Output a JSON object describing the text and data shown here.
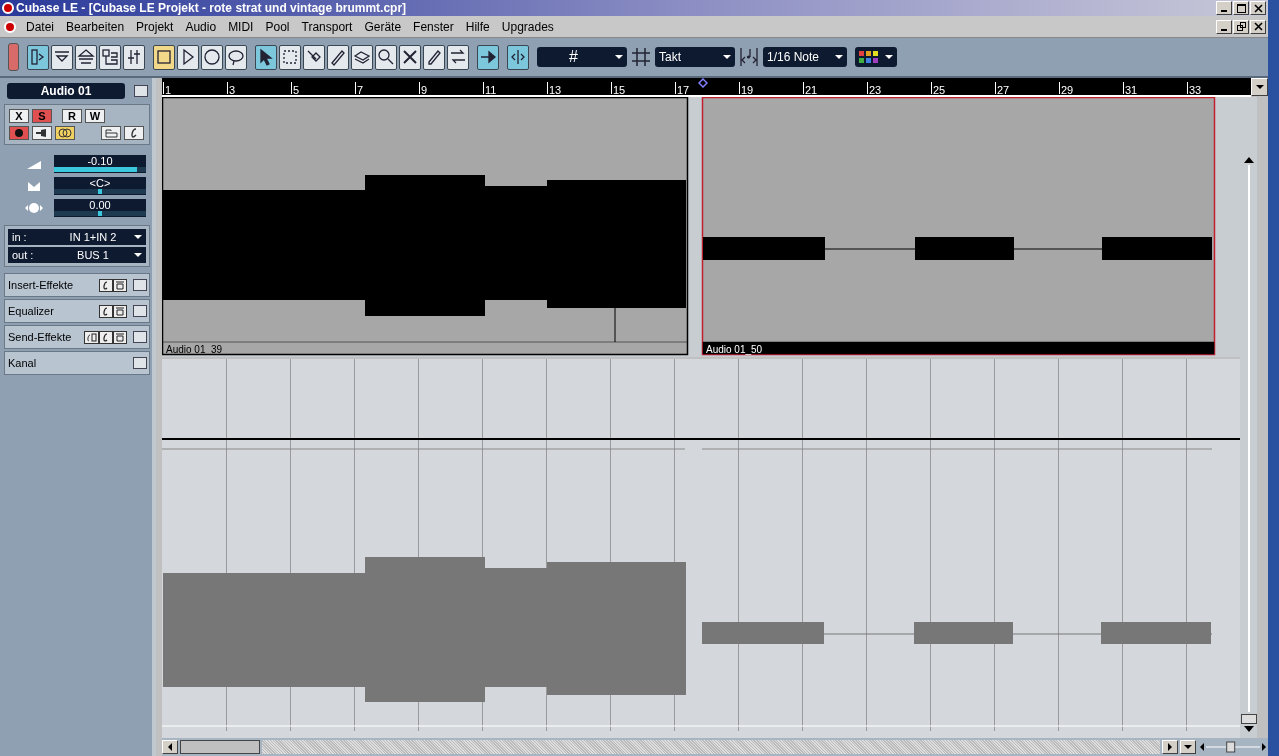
{
  "window": {
    "title": "Cubase LE - [Cubase LE Projekt - rote strat und vintage brummt.cpr]"
  },
  "menu": [
    "Datei",
    "Bearbeiten",
    "Projekt",
    "Audio",
    "MIDI",
    "Pool",
    "Transport",
    "Geräte",
    "Fenster",
    "Hilfe",
    "Upgrades"
  ],
  "toolbar": {
    "groups": [
      {
        "buttons": [
          {
            "selected": true
          },
          {
            "selected": false
          },
          {
            "selected": false
          },
          {
            "selected": false
          },
          {
            "selected": false
          }
        ]
      },
      {
        "buttons": [
          {
            "selected": true
          },
          {
            "selected": false
          },
          {
            "selected": false
          },
          {
            "selected": false
          }
        ]
      },
      {
        "buttons": [
          {
            "selected": true
          },
          {
            "selected": false
          },
          {
            "selected": false
          },
          {
            "selected": false
          },
          {
            "selected": false
          },
          {
            "selected": false
          },
          {
            "selected": false
          },
          {
            "selected": false
          },
          {
            "selected": false
          }
        ]
      },
      {
        "buttons": [
          {
            "selected": true
          }
        ]
      },
      {
        "buttons": [
          {
            "selected": true
          }
        ]
      }
    ],
    "grid_label": "#",
    "snap": "Takt",
    "quantize": "1/16 Note"
  },
  "inspector": {
    "track_name": "Audio 01",
    "text_buttons": [
      {
        "label": "X",
        "selected": false
      },
      {
        "label": "S",
        "selected": true
      },
      {
        "label": "R",
        "selected": false
      },
      {
        "label": "W",
        "selected": false
      }
    ],
    "icon_buttons": [
      {
        "selected": true
      },
      {
        "selected": false
      },
      {
        "selected": true
      },
      {
        "selected": false
      },
      {
        "selected": false
      }
    ],
    "faders": [
      {
        "reading": "-0.10",
        "level": 0.9
      },
      {
        "reading": "<C>",
        "level": 0.5
      },
      {
        "reading": "0.00",
        "level": 0.5
      }
    ],
    "routing": [
      {
        "label": "in :",
        "value": "IN 1+IN 2"
      },
      {
        "label": "out :",
        "value": "BUS 1"
      }
    ],
    "sections": [
      {
        "label": "Insert-Effekte"
      },
      {
        "label": "Equalizer"
      },
      {
        "label": "Send-Effekte"
      },
      {
        "label": "Kanal"
      }
    ]
  },
  "zoom_slider": {
    "level": 0.45
  },
  "ruler": [
    "1",
    "3",
    "5",
    "7",
    "9",
    "11",
    "13",
    "15",
    "17",
    "19",
    "21",
    "23",
    "25",
    "27",
    "29",
    "31",
    "33"
  ],
  "events": [
    {
      "name": "Audio 01_39",
      "selected": false
    },
    {
      "name": "Audio 01_50",
      "selected": true
    }
  ]
}
